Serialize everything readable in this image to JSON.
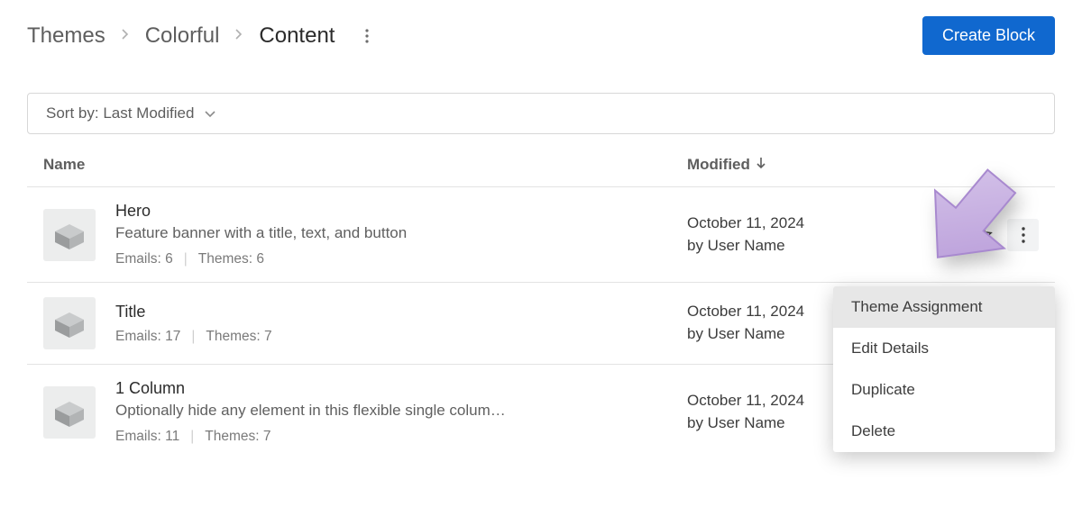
{
  "header": {
    "breadcrumbs": [
      "Themes",
      "Colorful",
      "Content"
    ],
    "create_label": "Create Block"
  },
  "sort": {
    "prefix": "Sort by:",
    "value": "Last Modified"
  },
  "columns": {
    "name": "Name",
    "modified": "Modified"
  },
  "rows": [
    {
      "title": "Hero",
      "desc": "Feature banner with a title, text, and button",
      "emails_label": "Emails:",
      "emails": "6",
      "themes_label": "Themes:",
      "themes": "6",
      "modified_date": "October 11, 2024",
      "modified_by": "by User Name"
    },
    {
      "title": "Title",
      "desc": "",
      "emails_label": "Emails:",
      "emails": "17",
      "themes_label": "Themes:",
      "themes": "7",
      "modified_date": "October 11, 2024",
      "modified_by": "by User Name"
    },
    {
      "title": "1 Column",
      "desc": "Optionally hide any element in this flexible single colum…",
      "emails_label": "Emails:",
      "emails": "11",
      "themes_label": "Themes:",
      "themes": "7",
      "modified_date": "October 11, 2024",
      "modified_by": "by User Name"
    }
  ],
  "menu": {
    "items": [
      "Theme Assignment",
      "Edit Details",
      "Duplicate",
      "Delete"
    ]
  },
  "icons": {
    "more": "more-vertical-icon",
    "star": "star-outline-icon",
    "chevron_right": "chevron-right-icon",
    "chevron_down": "chevron-down-icon",
    "arrow_down": "arrow-down-icon",
    "block": "block-thumb-icon"
  },
  "colors": {
    "primary": "#1068cf",
    "arrow_fill": "#c4aee0",
    "arrow_stroke": "#a889cf"
  }
}
